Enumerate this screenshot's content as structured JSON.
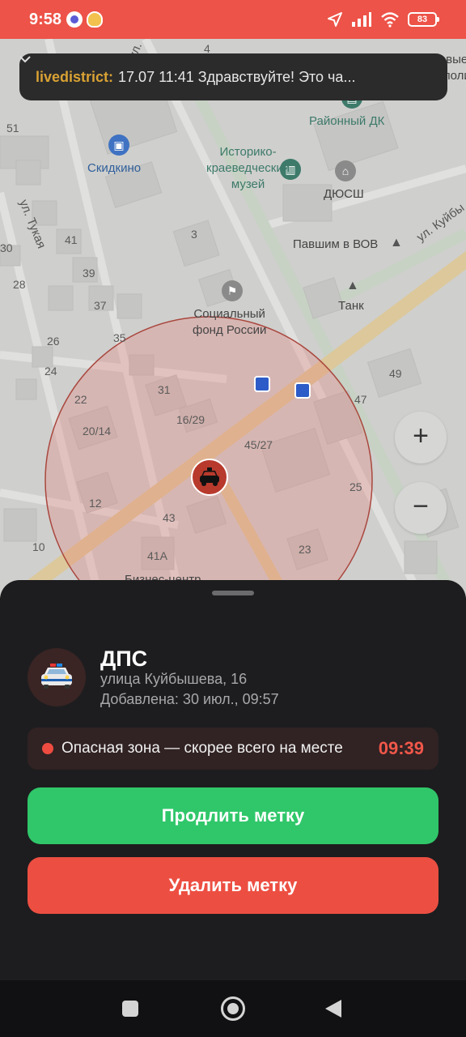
{
  "status_bar": {
    "time": "9:58",
    "battery": "83",
    "icons": [
      "app-notification-icon",
      "app-notification-icon-2",
      "location-arrow-icon",
      "signal-icon",
      "wifi-icon",
      "battery-icon"
    ]
  },
  "notification": {
    "sender": "livedistrict:",
    "text": "17.07 11:41 Здравствуйте! Это ча..."
  },
  "map": {
    "labels": {
      "pension_fund": "Социальный\nфонд России",
      "museum": "Историко-\nкраеведческий\nмузей",
      "cinema": "Скидкино",
      "culture_house": "Районный ДК",
      "sports_school": "ДЮСШ",
      "memorial": "Павшим в ВОВ",
      "tank": "Танк",
      "police": "Участковые\nпункты полици",
      "business_center": "Бизнес-центр",
      "street_tukaya": "ул. Тукая",
      "street_kuibysheva": "ул. Куйбы",
      "street_top": "ая ул."
    },
    "house_numbers": [
      "4",
      "51",
      "41",
      "30",
      "28",
      "3",
      "39",
      "37",
      "26",
      "24",
      "35",
      "31",
      "22",
      "16/29",
      "20/14",
      "45/27",
      "49",
      "47",
      "25",
      "12",
      "43",
      "10",
      "41А",
      "23"
    ]
  },
  "zoom": {
    "in": "+",
    "out": "−"
  },
  "sheet": {
    "title": "ДПС",
    "address": "улица Куйбышева, 16",
    "added": "Добавлена: 30 июл., 09:57",
    "zone_text": "Опасная зона — скорее всего на месте",
    "timer": "09:39",
    "extend_label": "Продлить метку",
    "delete_label": "Удалить метку"
  },
  "colors": {
    "status_bar": "#ed5348",
    "extend_button": "#30c76a",
    "delete_button": "#ec4f42",
    "timer": "#f0574a",
    "sheet_bg": "#1d1d1f"
  }
}
